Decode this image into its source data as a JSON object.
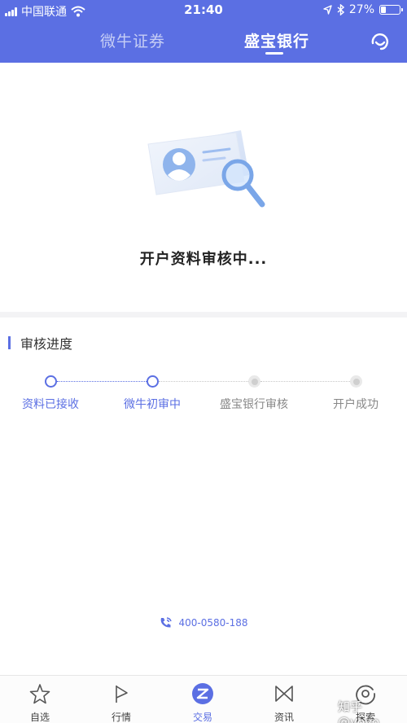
{
  "status_bar": {
    "carrier": "中国联通",
    "time": "21:40",
    "battery": "27%",
    "battery_level": 0.27
  },
  "header": {
    "tabs": [
      {
        "label": "微牛证券",
        "active": false
      },
      {
        "label": "盛宝银行",
        "active": true
      }
    ],
    "service_icon": "headset-icon"
  },
  "status": {
    "icon": "id-card-search-icon",
    "message": "开户资料审核中..."
  },
  "progress": {
    "title": "审核进度",
    "steps": [
      {
        "label": "资料已接收",
        "state": "done"
      },
      {
        "label": "微牛初审中",
        "state": "current"
      },
      {
        "label": "盛宝银行审核",
        "state": "pending"
      },
      {
        "label": "开户成功",
        "state": "pending"
      }
    ]
  },
  "hotline": {
    "icon": "phone-icon",
    "number": "400-0580-188"
  },
  "tabbar": {
    "items": [
      {
        "label": "自选",
        "icon": "star-icon",
        "active": false
      },
      {
        "label": "行情",
        "icon": "market-flag-icon",
        "active": false
      },
      {
        "label": "交易",
        "icon": "trade-icon",
        "active": true
      },
      {
        "label": "资讯",
        "icon": "news-icon",
        "active": false
      },
      {
        "label": "探索",
        "icon": "explore-icon",
        "active": false
      }
    ]
  },
  "watermark": "知乎 @yoyo",
  "colors": {
    "accent": "#5b6fe3",
    "divider": "#f3f3f5",
    "inactive": "#c6c6c6"
  }
}
